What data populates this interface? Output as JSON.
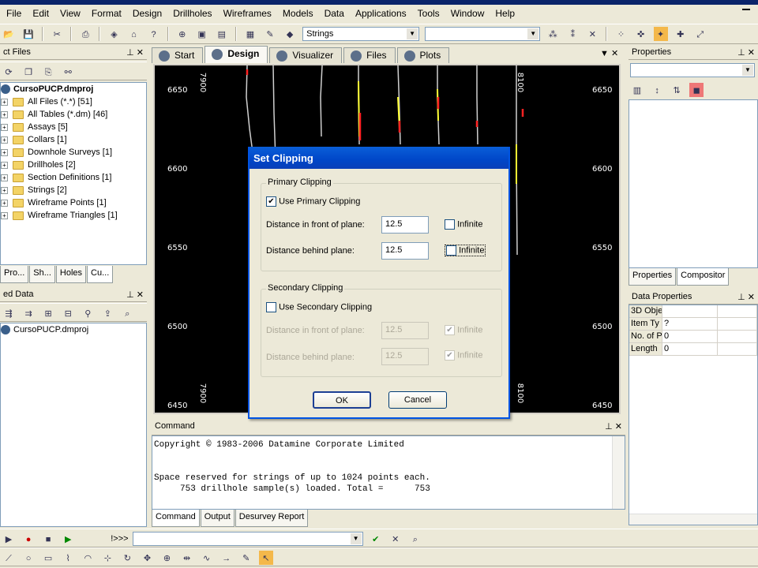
{
  "menu": [
    "File",
    "Edit",
    "View",
    "Format",
    "Design",
    "Drillholes",
    "Wireframes",
    "Models",
    "Data",
    "Applications",
    "Tools",
    "Window",
    "Help"
  ],
  "toolbar": {
    "strings_combo": "Strings",
    "second_combo": ""
  },
  "project_files": {
    "title": "ct Files",
    "root": "CursoPUCP.dmproj",
    "items": [
      "All Files (*.*) [51]",
      "All Tables (*.dm) [46]",
      "Assays [5]",
      "Collars [1]",
      "Downhole Surveys [1]",
      "Drillholes [2]",
      "Section Definitions [1]",
      "Strings [2]",
      "Wireframe Points [1]",
      "Wireframe Triangles [1]"
    ],
    "tabs": [
      "Pro...",
      "Sh...",
      "Holes",
      "Cu..."
    ]
  },
  "loaded_data": {
    "title": "ed Data",
    "item": "CursoPUCP.dmproj"
  },
  "doc_tabs": [
    "Start",
    "Design",
    "Visualizer",
    "Files",
    "Plots"
  ],
  "viewport": {
    "y_labels": [
      "6650",
      "6600",
      "6550",
      "6500",
      "6450"
    ],
    "x_labels_top": [
      "7900",
      "8100"
    ],
    "x_labels_bottom": [
      "7900",
      "8100"
    ]
  },
  "properties": {
    "title": "Properties",
    "tabs": [
      "Properties",
      "Compositor"
    ]
  },
  "data_properties": {
    "title": "Data Properties",
    "rows": [
      {
        "k": "3D Obje",
        "v": ""
      },
      {
        "k": "Item Ty",
        "v": "?"
      },
      {
        "k": "No. of P",
        "v": "0"
      },
      {
        "k": "Length",
        "v": "0"
      }
    ]
  },
  "command": {
    "title": "Command",
    "lines": [
      "Copyright © 1983-2006 Datamine Corporate Limited",
      "",
      "",
      "Space reserved for strings of up to 1024 points each.",
      "     753 drillhole sample(s) loaded. Total =      753"
    ],
    "tabs": [
      "Command",
      "Output",
      "Desurvey Report"
    ],
    "prompt": "!>>>"
  },
  "dialog": {
    "title": "Set Clipping",
    "primary": {
      "legend": "Primary Clipping",
      "use_label": "Use Primary Clipping",
      "front_label": "Distance in front of plane:",
      "front_value": "12.5",
      "behind_label": "Distance behind plane:",
      "behind_value": "12.5",
      "infinite": "Infinite"
    },
    "secondary": {
      "legend": "Secondary Clipping",
      "use_label": "Use Secondary Clipping",
      "front_label": "Distance in front of plane:",
      "front_value": "12.5",
      "behind_label": "Distance behind plane:",
      "behind_value": "12.5",
      "infinite": "Infinite"
    },
    "ok": "OK",
    "cancel": "Cancel"
  }
}
